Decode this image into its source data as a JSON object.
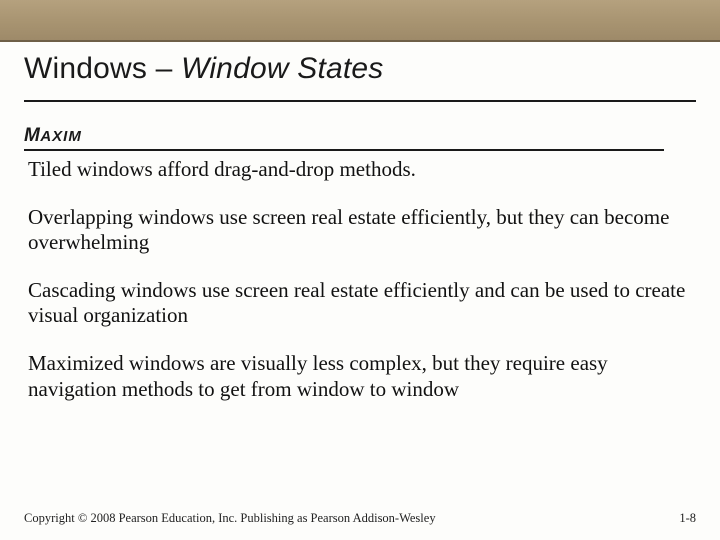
{
  "title": {
    "prefix": "Windows – ",
    "suffix": "Window States"
  },
  "maxim_label": {
    "cap": "M",
    "rest": "AXIM"
  },
  "paragraphs": {
    "p1": "Tiled windows afford drag-and-drop methods.",
    "p2": "Overlapping windows use screen real estate efficiently, but they can become overwhelming",
    "p3": "Cascading windows use screen real estate efficiently and can be used to create visual organization",
    "p4": "Maximized windows are visually less complex, but they require easy navigation methods to get from window to window"
  },
  "footer": {
    "copyright": "Copyright © 2008 Pearson Education, Inc. Publishing as Pearson Addison-Wesley",
    "page": "1-8"
  }
}
